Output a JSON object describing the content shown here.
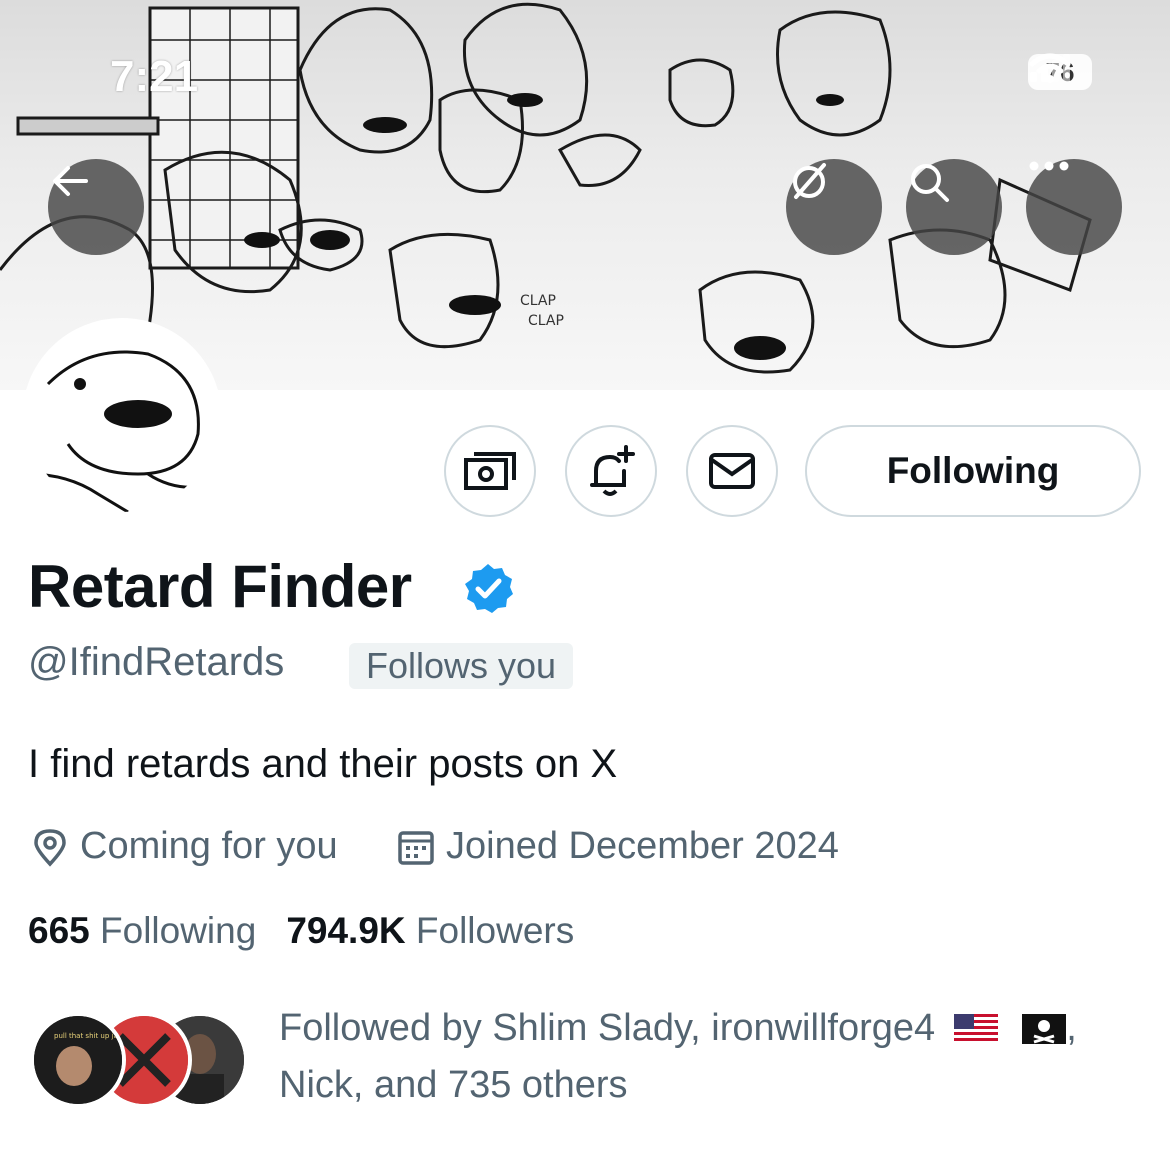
{
  "status_bar": {
    "time": "7:21",
    "battery": "76"
  },
  "header_nav": {
    "back_icon": "arrow-left-icon",
    "grok_icon": "grok-icon",
    "search_icon": "search-icon",
    "more_icon": "more-horizontal-icon"
  },
  "profile": {
    "display_name": "Retard Finder",
    "verified": true,
    "handle": "@IfindRetards",
    "follows_you": "Follows you",
    "bio": "I find retards and their posts on X",
    "location": "Coming for you",
    "joined": "Joined December 2024",
    "following_count": "665",
    "following_label": "Following",
    "followers_count": "794.9K",
    "followers_label": "Followers",
    "banner_text_1": "CLAP",
    "banner_text_2": "CLAP",
    "avatar_caption": "pull that shit up jamie"
  },
  "actions": {
    "tip_icon": "money-icon",
    "notify_icon": "bell-plus-icon",
    "message_icon": "envelope-icon",
    "following_button": "Following"
  },
  "followed_by": {
    "prefix": "Followed by Shlim Slady, ironwillforge4",
    "line2": "Nick, and 735 others"
  },
  "colors": {
    "accent_blue": "#1d9bf0",
    "secondary_text": "#536471",
    "border": "#cfd9de"
  }
}
